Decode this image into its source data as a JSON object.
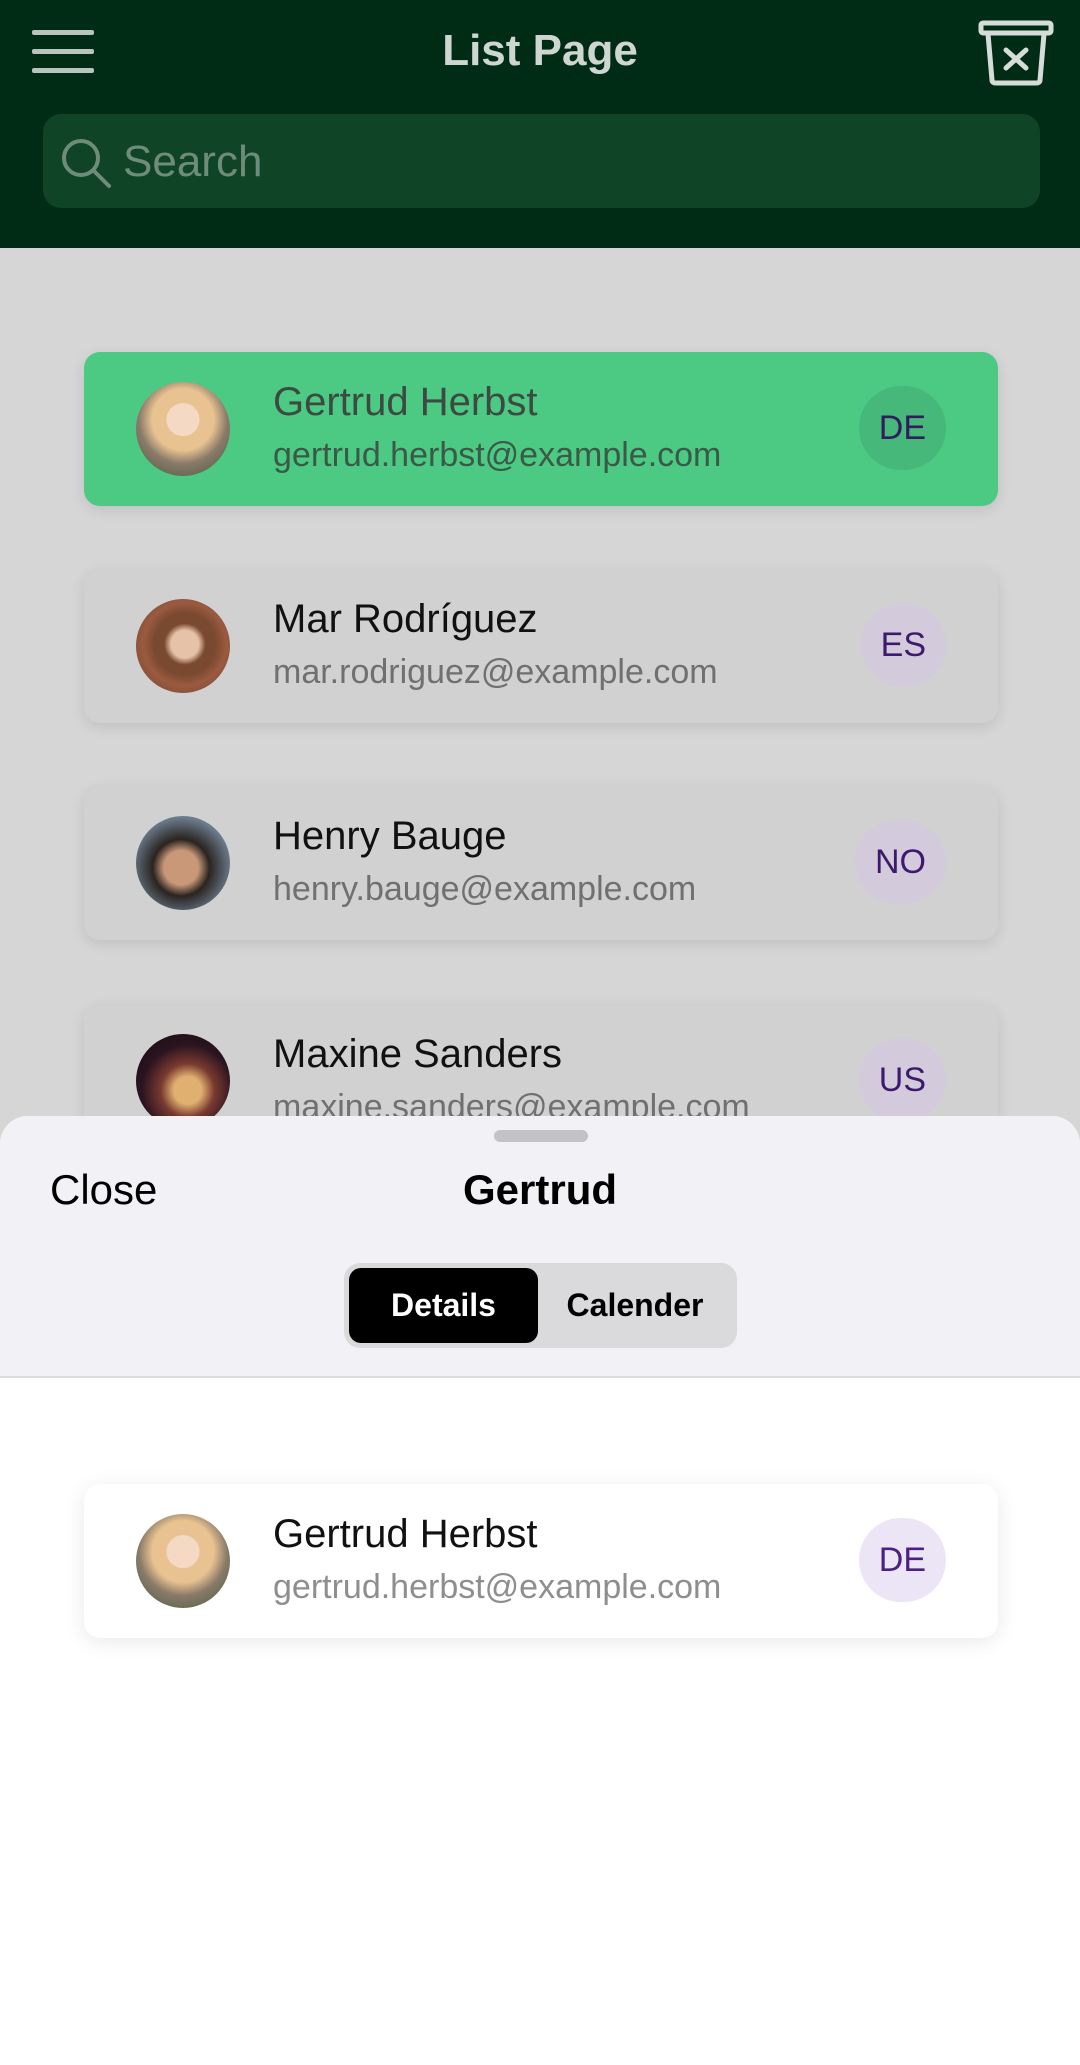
{
  "header": {
    "title": "List Page",
    "menu_icon": "hamburger-menu-icon",
    "trash_icon": "trash-x-icon",
    "search_placeholder": "Search",
    "search_icon": "search-icon",
    "background_color": "#002b14"
  },
  "list": {
    "items": [
      {
        "name": "Gertrud Herbst",
        "email": "gertrud.herbst@example.com",
        "country": "DE",
        "selected": true
      },
      {
        "name": "Mar Rodríguez",
        "email": "mar.rodriguez@example.com",
        "country": "ES",
        "selected": false
      },
      {
        "name": "Henry Bauge",
        "email": "henry.bauge@example.com",
        "country": "NO",
        "selected": false
      },
      {
        "name": "Maxine Sanders",
        "email": "maxine.sanders@example.com",
        "country": "US",
        "selected": false
      }
    ],
    "selected_color": "#4cca84"
  },
  "sheet": {
    "close_label": "Close",
    "title": "Gertrud",
    "tabs": [
      {
        "label": "Details",
        "active": true
      },
      {
        "label": "Calender",
        "active": false
      }
    ],
    "detail": {
      "name": "Gertrud Herbst",
      "email": "gertrud.herbst@example.com",
      "country": "DE"
    }
  }
}
